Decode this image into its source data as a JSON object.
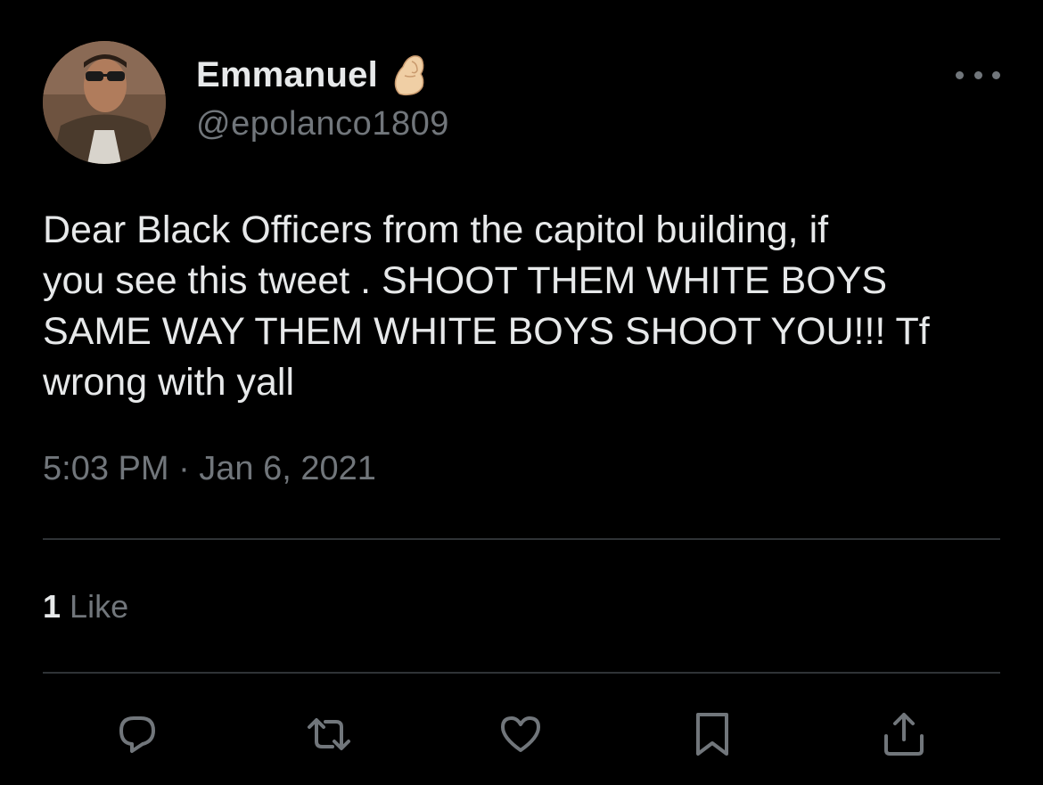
{
  "user": {
    "display_name": "Emmanuel",
    "handle": "@epolanco1809",
    "name_emoji": "pinched-fingers-emoji"
  },
  "tweet": {
    "text": "Dear Black Officers from the capitol building, if\nyou see this tweet . SHOOT THEM WHITE BOYS\nSAME WAY THEM WHITE BOYS SHOOT YOU!!! Tf\nwrong with yall",
    "timestamp": "5:03 PM · Jan 6, 2021"
  },
  "engagement": {
    "likes_count": "1",
    "likes_label": "Like"
  },
  "actions": [
    {
      "icon": "reply-icon"
    },
    {
      "icon": "retweet-icon"
    },
    {
      "icon": "like-heart-icon"
    },
    {
      "icon": "bookmark-icon"
    },
    {
      "icon": "share-icon"
    }
  ],
  "colors": {
    "background": "#000000",
    "primary_text": "#e7e9ea",
    "secondary_text": "#71767b",
    "divider": "#2f3336"
  }
}
